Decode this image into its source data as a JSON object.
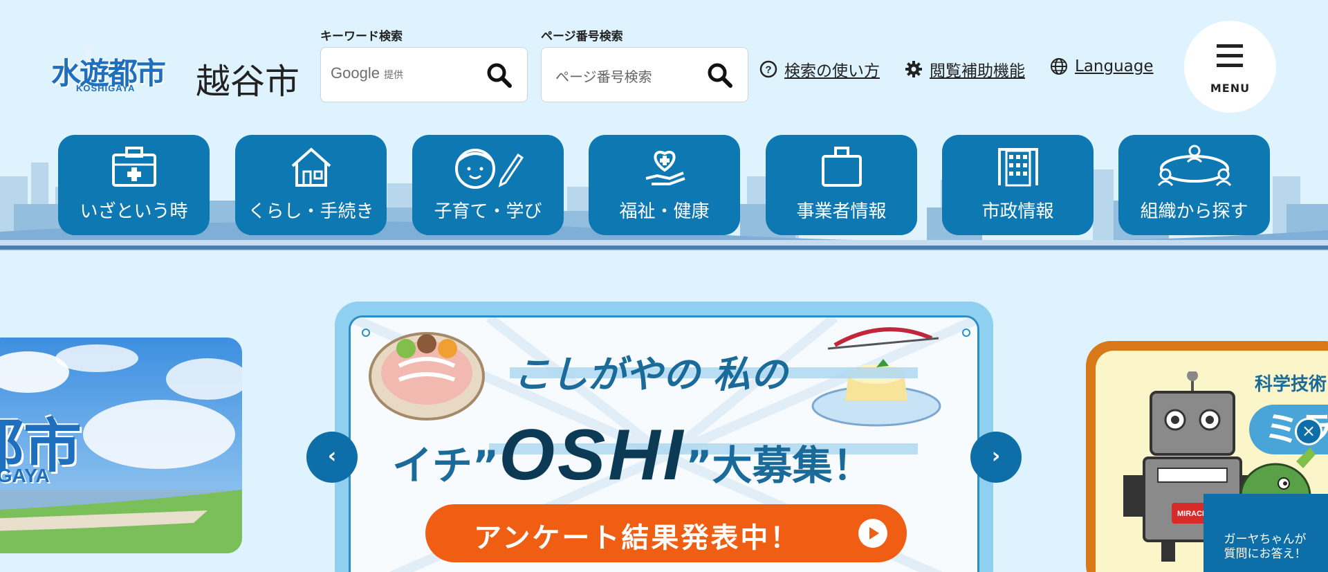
{
  "header": {
    "logo_text": "水遊都市",
    "logo_sub": "KOSHIGAYA",
    "city_name": "越谷市"
  },
  "keyword_search": {
    "label": "キーワード検索",
    "provider": "Google",
    "provider_suffix": "提供"
  },
  "page_search": {
    "label": "ページ番号検索",
    "placeholder": "ページ番号検索"
  },
  "utilities": {
    "search_help": "検索の使い方",
    "accessibility": "閲覧補助機能",
    "language": "Language"
  },
  "menu_label": "MENU",
  "nav": [
    {
      "label": "いざという時",
      "icon": "first-aid-kit-icon"
    },
    {
      "label": "くらし・手続き",
      "icon": "house-icon"
    },
    {
      "label": "子育て・学び",
      "icon": "child-face-pencil-icon"
    },
    {
      "label": "福祉・健康",
      "icon": "heart-hand-icon"
    },
    {
      "label": "事業者情報",
      "icon": "briefcase-icon"
    },
    {
      "label": "市政情報",
      "icon": "building-icon"
    },
    {
      "label": "組織から探す",
      "icon": "organization-icon"
    }
  ],
  "carousel": {
    "left_slide_text": "都市",
    "left_slide_sub": "IGAYA",
    "center": {
      "line1": "こしがやの 私の",
      "line2_prefix": "イチ”",
      "line2_big": "OSHI",
      "line2_suffix": "”大募集！",
      "button": "アンケート結果発表中！"
    },
    "right": {
      "title": "科学技術",
      "big": "ミラク",
      "badge": "MIRACLE"
    },
    "prev_symbol": "‹",
    "next_symbol": "›"
  },
  "chatbot": {
    "close_symbol": "×",
    "text_line1": "ガーヤちゃんが",
    "text_line2": "質問にお答え！"
  },
  "colors": {
    "background": "#def3fd",
    "nav_blue": "#0e78b3",
    "button_orange": "#f05e13",
    "accent_dark": "#0c3a55"
  }
}
